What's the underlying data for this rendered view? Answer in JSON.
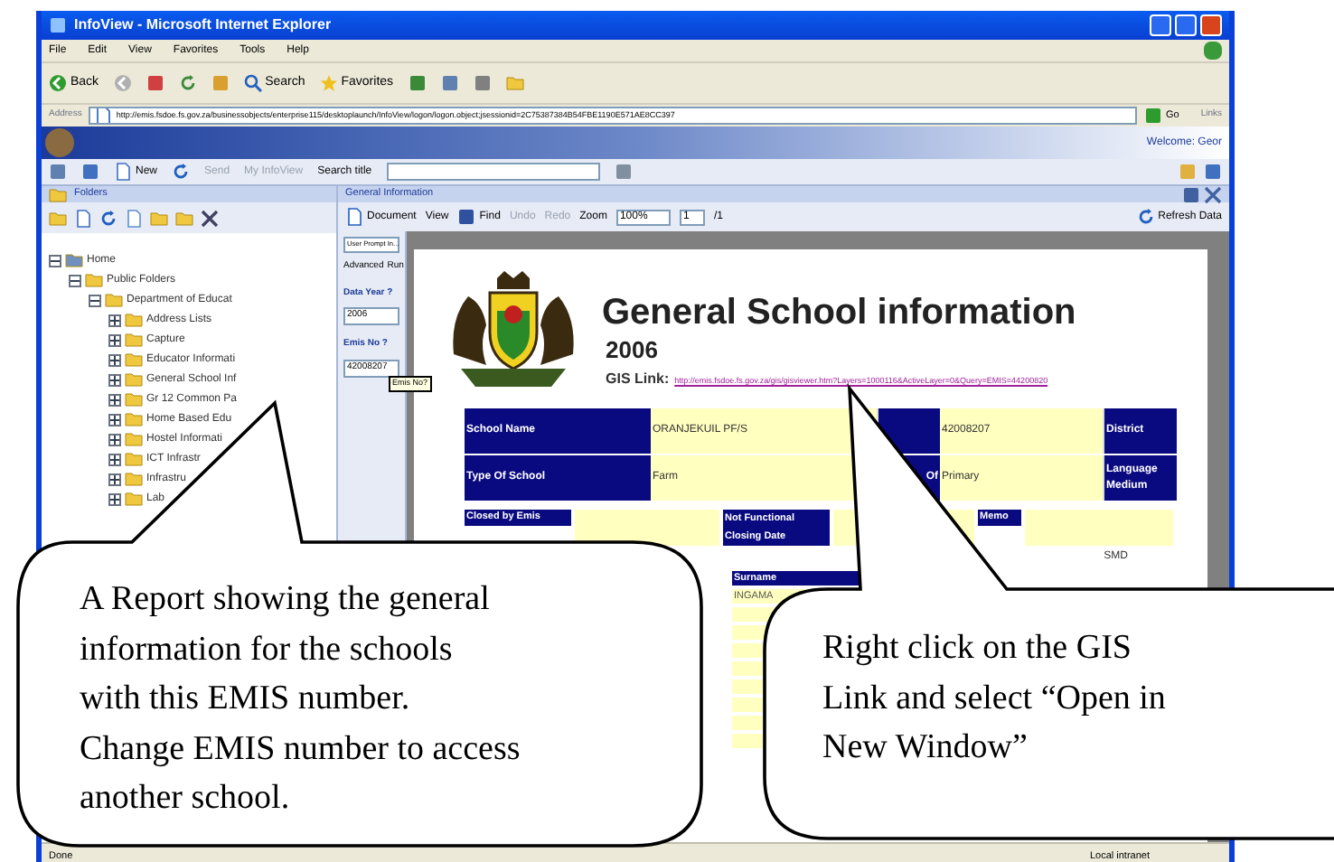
{
  "window": {
    "title": "InfoView - Microsoft Internet Explorer"
  },
  "menu": [
    "File",
    "Edit",
    "View",
    "Favorites",
    "Tools",
    "Help"
  ],
  "toolbar": {
    "back": "Back",
    "search": "Search",
    "favorites": "Favorites"
  },
  "address": {
    "label": "Address",
    "url": "http://emis.fsdoe.fs.gov.za/businessobjects/enterprise115/desktoplaunch/InfoView/logon/logon.object;jsessionid=2C75387384B54FBE1190E571AE8CC397",
    "go": "Go",
    "links": "Links"
  },
  "app_banner": {
    "welcome": "Welcome: Geor"
  },
  "app_toolbar": {
    "new": "New",
    "send": "Send",
    "my_infoview": "My InfoView",
    "search_label": "Search title"
  },
  "folders_panel": {
    "title": "Folders",
    "tree": [
      {
        "label": "Home",
        "expanded": true,
        "children": [
          {
            "label": "Public Folders",
            "expanded": true,
            "children": [
              {
                "label": "Department of Educat",
                "expanded": true,
                "children": [
                  {
                    "label": "Address Lists",
                    "expanded": false
                  },
                  {
                    "label": "Capture",
                    "expanded": false
                  },
                  {
                    "label": "Educator Informati",
                    "expanded": false
                  },
                  {
                    "label": "General School Inf",
                    "expanded": false
                  },
                  {
                    "label": "Gr 12 Common Pa",
                    "expanded": false
                  },
                  {
                    "label": "Home Based Edu",
                    "expanded": false
                  },
                  {
                    "label": "Hostel Informati",
                    "expanded": false
                  },
                  {
                    "label": "ICT Infrastr",
                    "expanded": false
                  },
                  {
                    "label": "Infrastru",
                    "expanded": false
                  },
                  {
                    "label": "Lab",
                    "expanded": false
                  }
                ]
              }
            ]
          }
        ]
      }
    ]
  },
  "report_panel": {
    "title": "General Information",
    "toolbar": {
      "document": "Document",
      "view": "View",
      "find": "Find",
      "undo": "Undo",
      "redo": "Redo",
      "zoom_label": "Zoom",
      "zoom": "100%",
      "page": "1",
      "page_count": "/1",
      "refresh": "Refresh Data"
    },
    "prompts": {
      "selector": "User Prompt In...",
      "advanced": "Advanced",
      "run": "Run",
      "fields": [
        {
          "label": "Data Year ?",
          "value": "2006"
        },
        {
          "label": "Emis No ?",
          "value": "42008207"
        }
      ],
      "tooltip": "Emis No?"
    },
    "report": {
      "title": "General School information",
      "year": "2006",
      "gis_label": "GIS Link:",
      "gis_url": "http://emis.fsdoe.fs.gov.za/gis/gisviewer.htm?Layers=1000116&ActiveLayer=0&Query=EMIS=44200820",
      "rows": [
        [
          "School Name",
          "ORANJEKUIL PF/S",
          null,
          "42008207",
          "District"
        ],
        [
          "Type Of School",
          "Farm",
          "Of",
          "Primary",
          "Language Medium"
        ]
      ],
      "closed_row": [
        "Closed by Emis",
        "Not Functional Closing Date",
        "Memo"
      ],
      "smd": "SMD",
      "surname_label": "Surname",
      "surname_value": "INGAMA"
    }
  },
  "status_bar": {
    "left": "Done",
    "right": "Local intranet"
  },
  "callouts": [
    {
      "text": "A Report showing the general\ninformation for the schools\nwith this EMIS number.\nChange EMIS number to access\nanother school."
    },
    {
      "text": "Right click on the GIS\nLink and select “Open in\nNew Window”"
    }
  ]
}
